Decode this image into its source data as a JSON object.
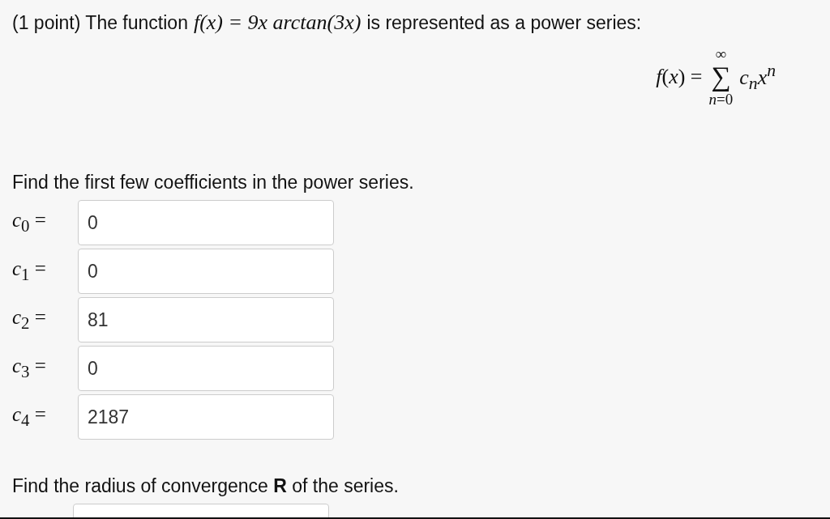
{
  "problem": {
    "lead": "(1 point) The function",
    "formula": "f(x) = 9x arctan(3x)",
    "tail": "is represented as a power series:"
  },
  "series_formula": {
    "lhs": "*f*(*x*) =",
    "upper": "∞",
    "sigma": "∑",
    "lower": "*n*=0",
    "term": "c$_{n}$x$^{n}$"
  },
  "coefficients_prompt": "Find the first few coefficients in the power series.",
  "coefficients": [
    {
      "label": "*c*$_{0}$ =",
      "value": "0"
    },
    {
      "label": "*c*$_{1}$ =",
      "value": "0"
    },
    {
      "label": "*c*$_{2}$ =",
      "value": "81"
    },
    {
      "label": "*c*$_{3}$ =",
      "value": "0"
    },
    {
      "label": "*c*$_{4}$ =",
      "value": "2187"
    }
  ],
  "radius_prompt": "Find the radius of convergence **R** of the series."
}
